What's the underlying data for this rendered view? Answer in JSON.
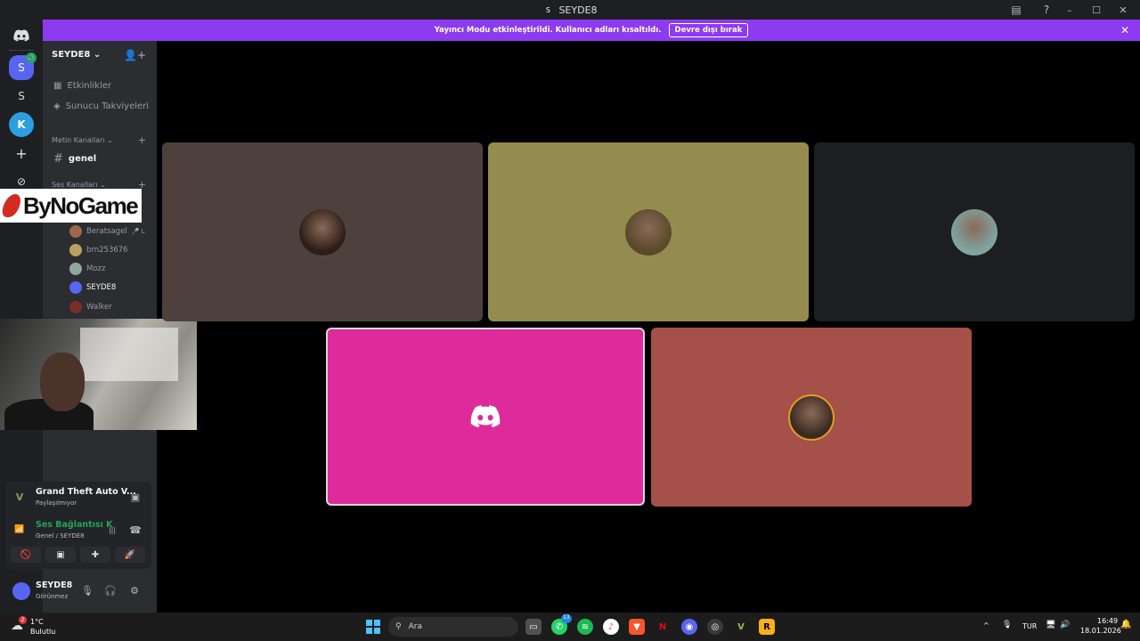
{
  "window": {
    "title": "SEYDE8",
    "server_initial": "S"
  },
  "window_controls": {
    "minimize": "–",
    "maximize": "☐",
    "close": "✕"
  },
  "banner": {
    "message": "Yayıncı Modu etkinleştirildi. Kullanıcı adları kısaltıldı.",
    "button": "Devre dışı bırak",
    "close": "✕",
    "color": "#8c3bf0"
  },
  "guilds": [
    {
      "label": "S",
      "badge": "🔊"
    },
    {
      "label": "S"
    },
    {
      "label": "K"
    },
    {
      "label": "+"
    },
    {
      "label": "⊘"
    }
  ],
  "sidebar": {
    "server_name": "SEYDE8",
    "server_chevron": "⌄",
    "invite_icon": "👤+",
    "nav": [
      {
        "label": "Etkinlikler",
        "icon": "▦"
      },
      {
        "label": "Sunucu Takviyeleri",
        "icon": "◈"
      }
    ],
    "categories": {
      "text": "Metin Kanalları ⌄",
      "voice": "Ses Kanalları ⌄",
      "plus": "+"
    },
    "text_channel": {
      "hash": "#",
      "name": "genel"
    },
    "members": [
      {
        "name": "Beratsagel",
        "suffix": "🎤 L",
        "color": "#a0664a"
      },
      {
        "name": "brn253676",
        "color": "#b8a060"
      },
      {
        "name": "Mozz",
        "color": "#8fa7a0"
      },
      {
        "name": "SEYDE8",
        "color": "#5865f2"
      },
      {
        "name": "Walker",
        "color": "#7a2e26"
      }
    ]
  },
  "overlay_logo": {
    "text": "ByNoGame"
  },
  "activity": {
    "game": "Grand Theft Auto V...",
    "status": "Paylaşılmıyor",
    "game_icon": "V",
    "share_icon": "▣"
  },
  "voice": {
    "status": "Ses Bağlantısı K",
    "location": "Genel / SEYDE8",
    "signal_icon": "📶",
    "noise_icon": "|||",
    "disconnect_icon": "☎",
    "buttons": [
      "🚫",
      "▣",
      "✚",
      "🚀"
    ]
  },
  "user": {
    "name": "SEYDE8",
    "status": "Görünmez",
    "mic_icon": "🎙",
    "headphones_icon": "🎧",
    "settings_icon": "⚙"
  },
  "tiles": [
    {
      "color": "#4e413d",
      "avatar": "#2d1d16"
    },
    {
      "color": "#948c4e",
      "avatar": "#5a4a2a"
    },
    {
      "color": "#1c1e1f",
      "avatar": "#7fa4a2"
    },
    {
      "color": "#de2a9b",
      "avatar": "",
      "logo": "discord"
    },
    {
      "color": "#a55048",
      "avatar": "#3c2a20"
    }
  ],
  "taskbar": {
    "weather_temp": "1°C",
    "weather_desc": "Bulutlu",
    "weather_badge": "2",
    "search_placeholder": "Ara",
    "whatsapp_badge": "13",
    "lang": "TUR",
    "time": "16:49",
    "date": "18.01.2026",
    "tray_up": "^"
  }
}
